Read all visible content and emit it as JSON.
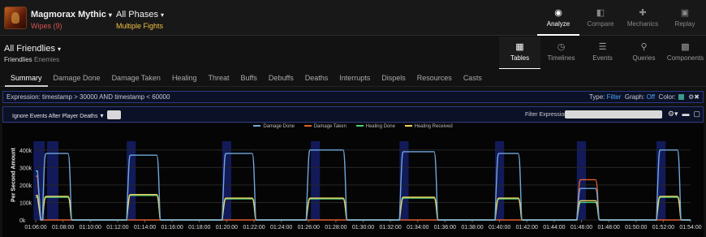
{
  "header": {
    "boss_name": "Magmorax Mythic",
    "wipes": "Wipes (9)",
    "phase_name": "All Phases",
    "phase_sub": "Multiple Fights",
    "nav": [
      {
        "label": "Analyze",
        "icon": "eye-icon",
        "active": true
      },
      {
        "label": "Compare",
        "icon": "compare-icon",
        "active": false
      },
      {
        "label": "Mechanics",
        "icon": "puzzle-icon",
        "active": false
      },
      {
        "label": "Replay",
        "icon": "replay-icon",
        "active": false
      }
    ]
  },
  "subheader": {
    "title": "All Friendlies",
    "friendlies": "Friendlies",
    "enemies": "Enemies",
    "views": [
      {
        "label": "Tables",
        "icon": "table-icon",
        "active": true
      },
      {
        "label": "Timelines",
        "icon": "clock-icon",
        "active": false
      },
      {
        "label": "Events",
        "icon": "list-icon",
        "active": false
      },
      {
        "label": "Queries",
        "icon": "pin-icon",
        "active": false
      },
      {
        "label": "Components",
        "icon": "grid-icon",
        "active": false
      }
    ]
  },
  "tabs": [
    "Summary",
    "Damage Done",
    "Damage Taken",
    "Healing",
    "Threat",
    "Buffs",
    "Debuffs",
    "Deaths",
    "Interrupts",
    "Dispels",
    "Resources",
    "Casts"
  ],
  "expression": {
    "label": "Expression:",
    "value": "timestamp > 30000 AND timestamp < 60000",
    "type_label": "Type:",
    "type_value": "Filter",
    "graph_label": "Graph:",
    "graph_value": "Off",
    "color_label": "Color:",
    "color_value": "#3a9a8a"
  },
  "panel": {
    "ignore_label": "Ignore Events After Player Deaths",
    "filter_label": "Filter Expression:",
    "filter_value": ""
  },
  "chart_data": {
    "type": "line",
    "ylabel": "Per Second Amount",
    "ylim": [
      0,
      450000
    ],
    "yticks": [
      "0k",
      "100k",
      "200k",
      "300k",
      "400k"
    ],
    "x": [
      "01:06:00",
      "01:08:00",
      "01:10:00",
      "01:12:00",
      "01:14:00",
      "01:16:00",
      "01:18:00",
      "01:20:00",
      "01:22:00",
      "01:24:00",
      "01:26:00",
      "01:28:00",
      "01:30:00",
      "01:32:00",
      "01:34:00",
      "01:36:00",
      "01:38:00",
      "01:40:00",
      "01:42:00",
      "01:44:00",
      "01:46:00",
      "01:48:00",
      "01:50:00",
      "01:52:00",
      "01:54:00"
    ],
    "legend_position": "top-center",
    "series": [
      {
        "name": "Damage Done",
        "color": "#6fa8dc"
      },
      {
        "name": "Damage Taken",
        "color": "#e06030"
      },
      {
        "name": "Healing Done",
        "color": "#4ad07a"
      },
      {
        "name": "Healing Received",
        "color": "#f0d060"
      }
    ],
    "pulls": [
      {
        "start": "01:06:00",
        "end": "01:08:40",
        "damage_done": 380000,
        "damage_taken": 0,
        "healing_done": 130000,
        "healing_received": 135000
      },
      {
        "start": "01:12:40",
        "end": "01:15:10",
        "damage_done": 370000,
        "damage_taken": 0,
        "healing_done": 140000,
        "healing_received": 145000
      },
      {
        "start": "01:19:40",
        "end": "01:22:10",
        "damage_done": 380000,
        "damage_taken": 0,
        "healing_done": 120000,
        "healing_received": 125000
      },
      {
        "start": "01:25:50",
        "end": "01:28:50",
        "damage_done": 400000,
        "damage_taken": 0,
        "healing_done": 120000,
        "healing_received": 125000
      },
      {
        "start": "01:32:40",
        "end": "01:35:30",
        "damage_done": 390000,
        "damage_taken": 0,
        "healing_done": 125000,
        "healing_received": 130000
      },
      {
        "start": "01:39:40",
        "end": "01:41:40",
        "damage_done": 380000,
        "damage_taken": 0,
        "healing_done": 120000,
        "healing_received": 125000
      },
      {
        "start": "01:45:40",
        "end": "01:47:20",
        "damage_done": 180000,
        "damage_taken": 230000,
        "healing_done": 100000,
        "healing_received": 110000
      },
      {
        "start": "01:51:30",
        "end": "01:53:20",
        "damage_done": 400000,
        "damage_taken": 0,
        "healing_done": 130000,
        "healing_received": 135000
      }
    ],
    "first_pull_lead_in": {
      "damage_done": 280000,
      "damage_taken": 250000,
      "healing_done": 130000,
      "healing_received": 140000
    },
    "highlight_bands": [
      [
        "01:05:50",
        "01:06:40"
      ],
      [
        "01:06:50",
        "01:07:40"
      ],
      [
        "01:12:40",
        "01:13:20"
      ],
      [
        "01:19:40",
        "01:20:20"
      ],
      [
        "01:26:10",
        "01:26:50"
      ],
      [
        "01:32:40",
        "01:33:20"
      ],
      [
        "01:39:40",
        "01:40:20"
      ],
      [
        "01:45:40",
        "01:46:20"
      ],
      [
        "01:51:30",
        "01:52:10"
      ]
    ]
  }
}
